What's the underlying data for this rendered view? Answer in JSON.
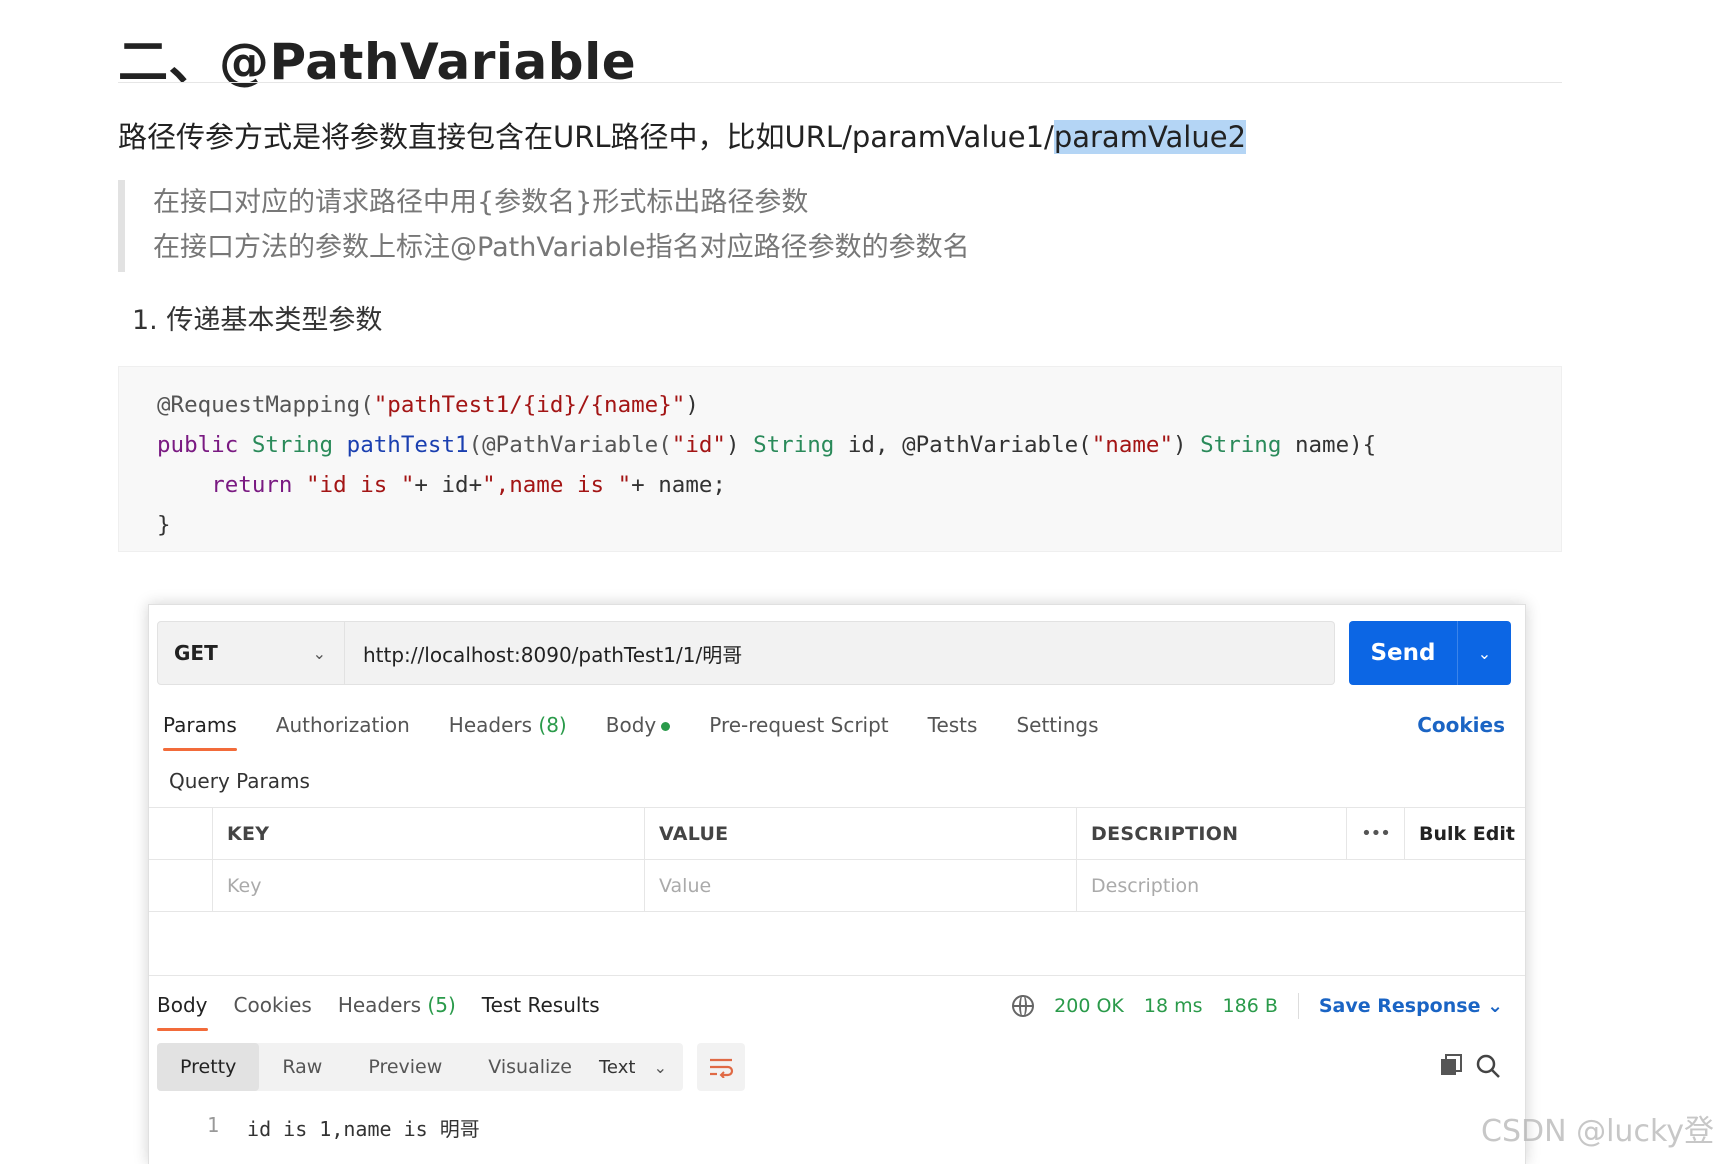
{
  "doc": {
    "title": "二、@PathVariable",
    "intro_prefix": "路径传参方式是将参数直接包含在URL路径中，比如URL/paramValue1/",
    "intro_highlight": "paramValue2",
    "quote_lines": [
      "在接口对应的请求路径中用{参数名}形式标出路径参数",
      "在接口方法的参数上标注@PathVariable指名对应路径参数的参数名"
    ],
    "list_item": "1. 传递基本类型参数"
  },
  "code": {
    "l1_ann": "@RequestMapping(",
    "l1_str": "\"pathTest1/{id}/{name}\"",
    "l1_end": ")",
    "l2_kw": "public",
    "l2_type1": "String",
    "l2_fn": "pathTest1",
    "l2_ann1": "(@PathVariable(",
    "l2_str1": "\"id\"",
    "l2_p1": ")",
    "l2_type2": "String",
    "l2_p2": "id, @PathVariable(",
    "l2_str2": "\"name\"",
    "l2_p3": ")",
    "l2_type3": "String",
    "l2_p4": "name){",
    "l3_kw": "return",
    "l3_str1": "\"id is \"",
    "l3_p1": "+ id+",
    "l3_str2": "\",name is \"",
    "l3_p2": "+ name;",
    "l4": "}"
  },
  "request": {
    "method": "GET",
    "url": "http://localhost:8090/pathTest1/1/明哥",
    "send_label": "Send",
    "tabs": {
      "params": "Params",
      "authorization": "Authorization",
      "headers": "Headers",
      "headers_count": "(8)",
      "body": "Body",
      "prerequest": "Pre-request Script",
      "tests": "Tests",
      "settings": "Settings"
    },
    "cookies_label": "Cookies",
    "query_params_label": "Query Params",
    "table": {
      "key_header": "KEY",
      "value_header": "VALUE",
      "description_header": "DESCRIPTION",
      "more_label": "•••",
      "bulk_edit": "Bulk Edit",
      "key_placeholder": "Key",
      "value_placeholder": "Value",
      "description_placeholder": "Description"
    }
  },
  "response": {
    "tabs": {
      "body": "Body",
      "cookies": "Cookies",
      "headers": "Headers",
      "headers_count": "(5)",
      "test_results": "Test Results"
    },
    "status": "200 OK",
    "time": "18 ms",
    "size": "186 B",
    "save_response": "Save Response",
    "views": {
      "pretty": "Pretty",
      "raw": "Raw",
      "preview": "Preview",
      "visualize": "Visualize"
    },
    "format": "Text",
    "line_number": "1",
    "line_text": "id is 1,name is 明哥"
  },
  "watermark": "CSDN @lucky登"
}
